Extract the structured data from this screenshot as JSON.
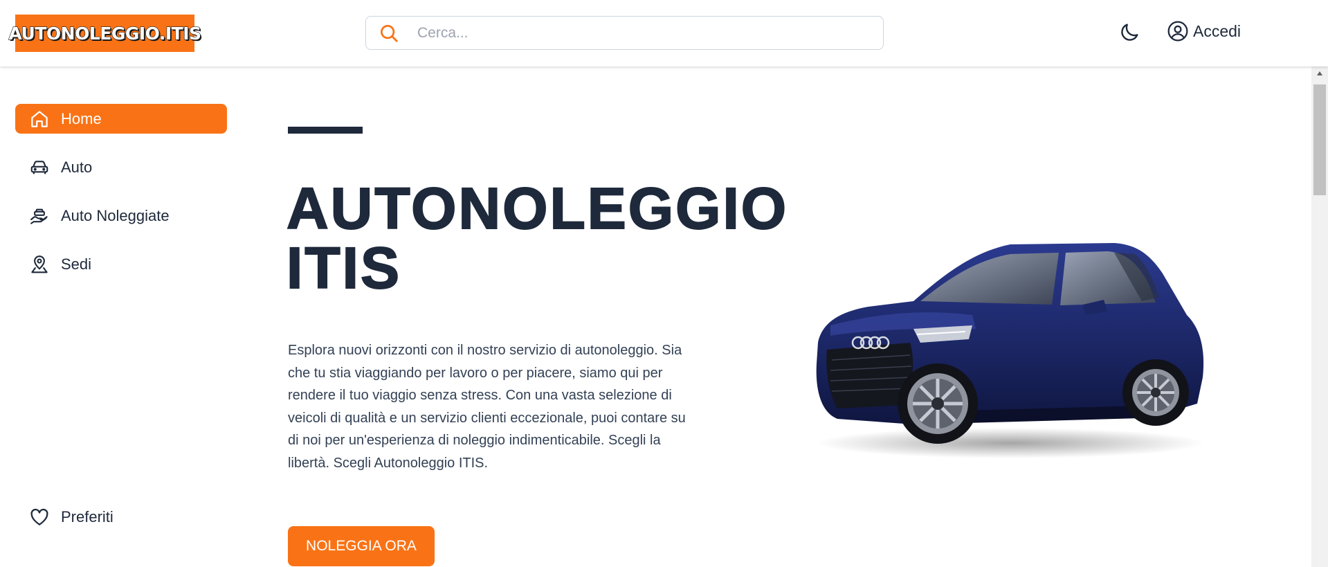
{
  "header": {
    "logo_text": "AUTONOLEGGIO.ITIS",
    "search_placeholder": "Cerca...",
    "login_label": "Accedi",
    "theme_icon": "moon-icon",
    "search_icon": "search-icon",
    "user_icon": "user-circle-icon"
  },
  "sidebar": {
    "items": [
      {
        "label": "Home",
        "icon": "home-icon",
        "active": true
      },
      {
        "label": "Auto",
        "icon": "car-icon",
        "active": false
      },
      {
        "label": "Auto Noleggiate",
        "icon": "hand-car-icon",
        "active": false
      },
      {
        "label": "Sedi",
        "icon": "map-pin-icon",
        "active": false
      }
    ],
    "favorites": {
      "label": "Preferiti",
      "icon": "heart-icon"
    }
  },
  "main": {
    "title_line1": "AUTONOLEGGIO",
    "title_line2": "ITIS",
    "description": "Esplora nuovi orizzonti con il nostro servizio di autonoleggio. Sia che tu stia viaggiando per lavoro o per piacere, siamo qui per rendere il tuo viaggio senza stress. Con una vasta selezione di veicoli di qualità e un servizio clienti eccezionale, puoi contare su di noi per un'esperienza di noleggio indimenticabile. Scegli la libertà. Scegli Autonoleggio ITIS.",
    "cta_label": "NOLEGGIA ORA",
    "hero_image": "blue-suv-car-image"
  },
  "colors": {
    "accent": "#f97316",
    "text_dark": "#1e293b",
    "car_body": "#1e2a6e"
  }
}
